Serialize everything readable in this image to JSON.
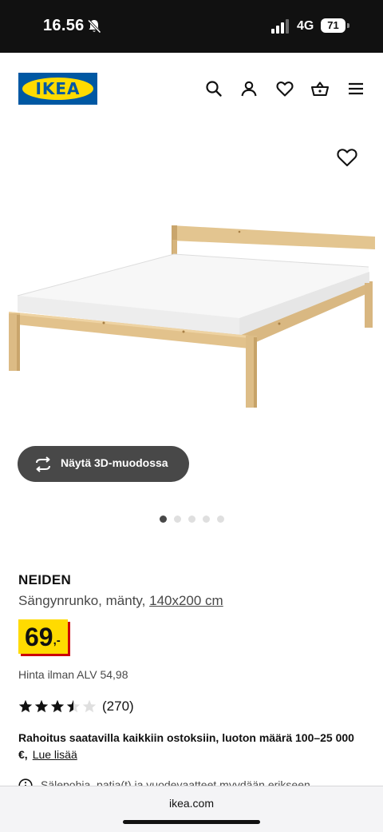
{
  "status_bar": {
    "time": "16.56",
    "network": "4G",
    "battery": "71"
  },
  "header": {
    "logo_text": "IKEA",
    "icons": [
      "search-icon",
      "user-icon",
      "heart-icon",
      "basket-icon",
      "menu-icon"
    ]
  },
  "gallery": {
    "view_3d_label": "Näytä 3D-muodossa",
    "image_count": 5,
    "active_image": 1
  },
  "product": {
    "name": "NEIDEN",
    "description": "Sängynrunko, mänty, ",
    "size": "140x200 cm",
    "price_integer": "69",
    "price_suffix": ",-",
    "price_ex_vat": "Hinta ilman ALV 54,98",
    "rating": 3.5,
    "rating_max": 5,
    "review_count": "(270)",
    "financing_text": "Rahoitus saatavilla kaikkiin ostoksiin, luoton määrä 100–25 000",
    "financing_currency": "€,",
    "financing_link": "Lue lisää",
    "notice_text": "Sälepohja, patja(t) ja vuodevaatteet myydään erikseen."
  },
  "browser": {
    "url": "ikea.com"
  },
  "colors": {
    "ikea_blue": "#0058a3",
    "ikea_yellow": "#ffdb00",
    "price_shadow": "#cc0008",
    "pill_bg": "#484848"
  }
}
